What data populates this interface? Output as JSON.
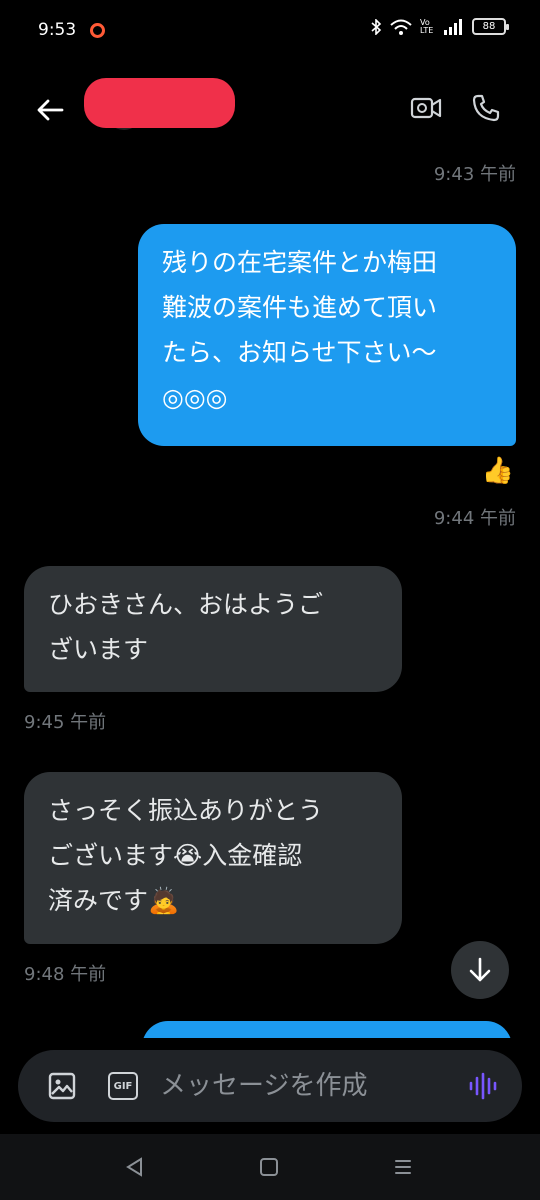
{
  "status_bar": {
    "time": "9:53",
    "battery": "88",
    "volte": "Vo LTE"
  },
  "header": {
    "icons": [
      "back-arrow-icon",
      "video-camera-icon",
      "phone-icon"
    ]
  },
  "messages": [
    {
      "type": "timestamp",
      "side": "right",
      "text": "9:43 午前"
    },
    {
      "type": "sent",
      "text": "残りの在宅案件とか梅田\n難波の案件も進めて頂い\nたら、お知らせ下さい〜\n◎◎◎"
    },
    {
      "type": "reaction",
      "text": "👍"
    },
    {
      "type": "timestamp",
      "side": "right",
      "text": "9:44 午前"
    },
    {
      "type": "received",
      "text": "ひおきさん、おはようご\nざいます"
    },
    {
      "type": "timestamp",
      "side": "left",
      "text": "9:45 午前"
    },
    {
      "type": "received",
      "text": "さっそく振込ありがとう\nございます😭入金確認\n済みです🙇"
    },
    {
      "type": "timestamp",
      "side": "left",
      "text": "9:48 午前"
    }
  ],
  "composer": {
    "placeholder": "メッセージを作成",
    "gif_label": "GIF"
  },
  "colors": {
    "sent_bubble": "#1d9bf0",
    "received_bubble": "#2f3336",
    "background": "#000000",
    "voice_accent": "#7856ff"
  }
}
